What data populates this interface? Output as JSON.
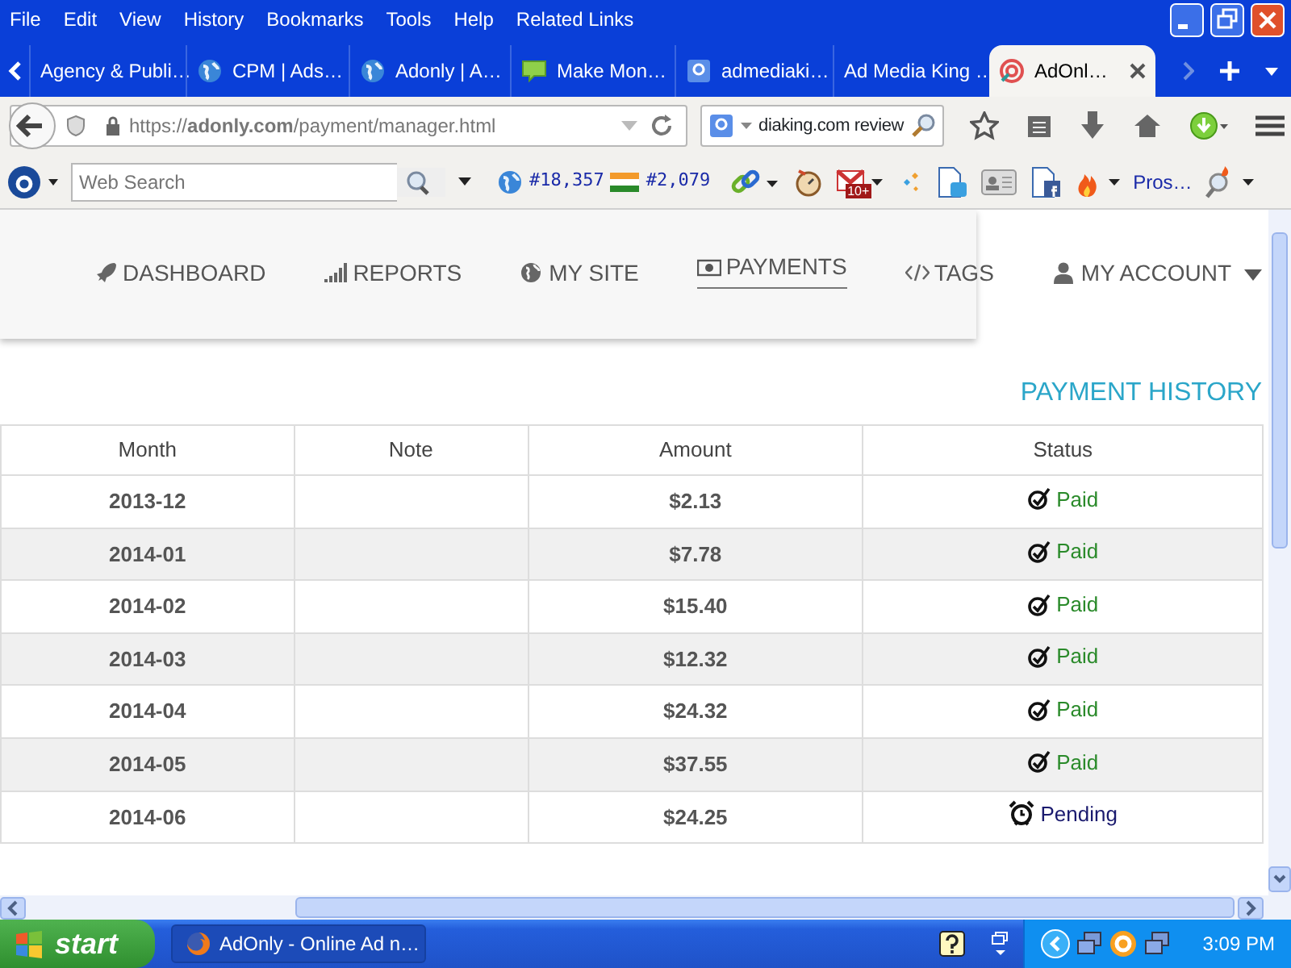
{
  "menu": [
    "File",
    "Edit",
    "View",
    "History",
    "Bookmarks",
    "Tools",
    "Help",
    "Related Links"
  ],
  "tabs": [
    {
      "label": "Agency & Publi…",
      "kind": "none",
      "selected": false
    },
    {
      "label": "CPM | Ads…",
      "kind": "globe",
      "selected": false
    },
    {
      "label": "Adonly | A…",
      "kind": "globe",
      "selected": false
    },
    {
      "label": "Make Mon…",
      "kind": "chat",
      "selected": false
    },
    {
      "label": "admediaki…",
      "kind": "google",
      "selected": false
    },
    {
      "label": "Ad Media King …",
      "kind": "none",
      "selected": false
    },
    {
      "label": "AdOnl…",
      "kind": "target",
      "selected": true
    }
  ],
  "address": {
    "url": "https://**adonly.com**/payment/manager.html"
  },
  "search": {
    "value": "diaking.com review"
  },
  "addon_bar": {
    "placeholder": "Web Search",
    "global_rank": "#18,357",
    "country_rank": "#2,079",
    "mail_badge": "10+",
    "pros": "Pros…"
  },
  "site_nav": [
    {
      "label": "DASHBOARD",
      "kind": "rocket",
      "selected": false
    },
    {
      "label": "REPORTS",
      "kind": "signal",
      "selected": false
    },
    {
      "label": "MY SITE",
      "kind": "globe",
      "selected": false
    },
    {
      "label": "PAYMENTS",
      "kind": "money",
      "selected": true
    },
    {
      "label": "TAGS",
      "kind": "code",
      "selected": false
    },
    {
      "label": "MY ACCOUNT",
      "kind": "user",
      "selected": false
    }
  ],
  "heading": "PAYMENT HISTORY",
  "table": {
    "columns": [
      "Month",
      "Note",
      "Amount",
      "Status"
    ],
    "rows": [
      {
        "month": "2013-12",
        "amount": "$2.13",
        "status": {
          "kind": "paid",
          "label": "Paid"
        }
      },
      {
        "month": "2014-01",
        "amount": "$7.78",
        "status": {
          "kind": "paid",
          "label": "Paid"
        }
      },
      {
        "month": "2014-02",
        "amount": "$15.40",
        "status": {
          "kind": "paid",
          "label": "Paid"
        }
      },
      {
        "month": "2014-03",
        "amount": "$12.32",
        "status": {
          "kind": "paid",
          "label": "Paid"
        }
      },
      {
        "month": "2014-04",
        "amount": "$24.32",
        "status": {
          "kind": "paid",
          "label": "Paid"
        }
      },
      {
        "month": "2014-05",
        "amount": "$37.55",
        "status": {
          "kind": "paid",
          "label": "Paid"
        }
      },
      {
        "month": "2014-06",
        "amount": "$24.25",
        "status": {
          "kind": "pending",
          "label": "Pending"
        }
      }
    ]
  },
  "taskbar": {
    "start": "start",
    "task": "AdOnly - Online Ad n…",
    "clock": "3:09 PM"
  }
}
